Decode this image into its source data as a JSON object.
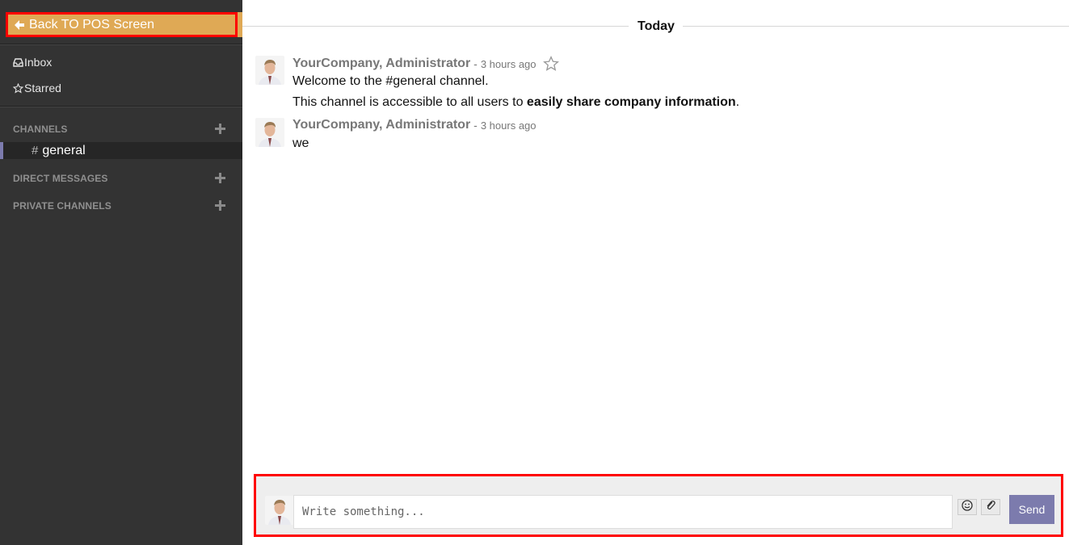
{
  "sidebar": {
    "back_button": "Back TO POS Screen",
    "mailboxes": [
      {
        "label": "Inbox",
        "icon": "inbox-icon"
      },
      {
        "label": "Starred",
        "icon": "star-outline-icon"
      }
    ],
    "channels_heading": "CHANNELS",
    "channels": [
      {
        "name": "general"
      }
    ],
    "direct_messages_heading": "DIRECT MESSAGES",
    "private_channels_heading": "PRIVATE CHANNELS"
  },
  "thread": {
    "day_label": "Today",
    "messages": [
      {
        "author": "YourCompany, Administrator",
        "separator": "-",
        "time": "3 hours ago",
        "line1": "Welcome to the #general channel.",
        "line2_prefix": "This channel is accessible to all users to ",
        "line2_bold": "easily share company information",
        "line2_suffix": "."
      },
      {
        "author": "YourCompany, Administrator",
        "separator": "-",
        "time": "3 hours ago",
        "line1": "we"
      }
    ]
  },
  "composer": {
    "placeholder": "Write something...",
    "send_label": "Send",
    "emoji_icon": "smiley-icon",
    "attach_icon": "paperclip-icon"
  },
  "colors": {
    "sidebar_bg": "#333333",
    "back_button_bg": "#dfa955",
    "highlight_border": "#ff0000",
    "accent": "#7c7bad"
  }
}
